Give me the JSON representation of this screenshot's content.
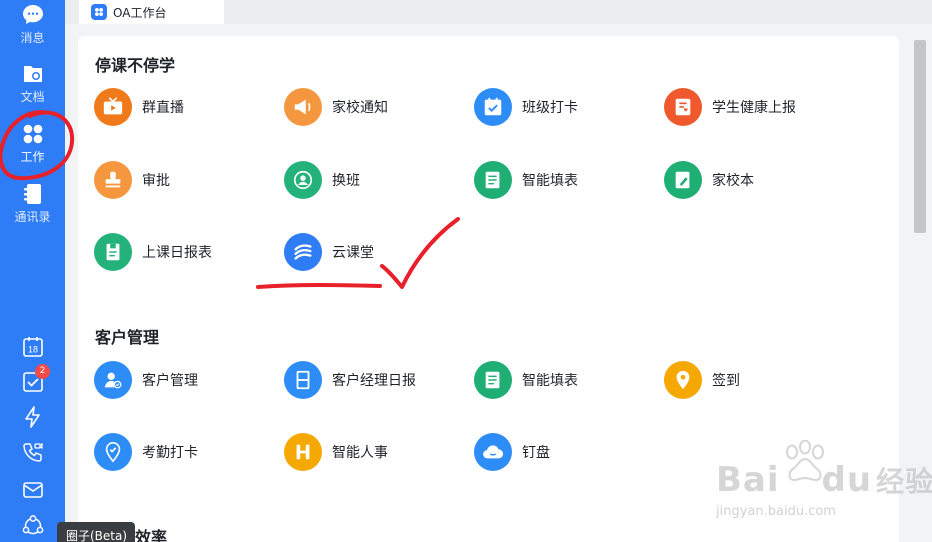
{
  "sidebar": {
    "nav": [
      {
        "label": "消息",
        "icon": "chat-bubble-icon"
      },
      {
        "label": "文档",
        "icon": "document-folder-icon"
      },
      {
        "label": "工作",
        "icon": "workbench-grid-icon",
        "active": true
      },
      {
        "label": "通讯录",
        "icon": "contacts-book-icon"
      }
    ],
    "bottom_icons": [
      "calendar-icon",
      "todo-check-icon",
      "lightning-icon",
      "phone-video-icon",
      "mail-icon",
      "circle-network-icon"
    ],
    "calendar_day": "18",
    "todo_badge": "2",
    "tooltip": "圈子(Beta)"
  },
  "tab": {
    "label": "OA工作台"
  },
  "sections": [
    {
      "title": "停课不停学",
      "apps": [
        {
          "name": "群直播",
          "color": "#f07a1a",
          "icon": "tv-live-icon"
        },
        {
          "name": "家校通知",
          "color": "#f5973f",
          "icon": "megaphone-icon"
        },
        {
          "name": "班级打卡",
          "color": "#2e8cf6",
          "icon": "calendar-check-icon"
        },
        {
          "name": "学生健康上报",
          "color": "#f0582d",
          "icon": "health-report-icon"
        },
        {
          "name": "审批",
          "color": "#f5973f",
          "icon": "stamp-icon"
        },
        {
          "name": "换班",
          "color": "#25b27a",
          "icon": "person-swap-icon"
        },
        {
          "name": "智能填表",
          "color": "#1fae73",
          "icon": "form-sheet-icon"
        },
        {
          "name": "家校本",
          "color": "#1fae73",
          "icon": "notebook-pen-icon"
        },
        {
          "name": "上课日报表",
          "color": "#25b27a",
          "icon": "daily-report-icon"
        },
        {
          "name": "云课堂",
          "color": "#2e7cf6",
          "icon": "cloud-class-icon"
        }
      ]
    },
    {
      "title": "客户管理",
      "apps": [
        {
          "name": "客户管理",
          "color": "#2e8cf6",
          "icon": "customer-person-icon"
        },
        {
          "name": "客户经理日报",
          "color": "#2e8cf6",
          "icon": "manager-daily-icon"
        },
        {
          "name": "智能填表",
          "color": "#1fae73",
          "icon": "form-sheet-icon"
        },
        {
          "name": "签到",
          "color": "#f5a800",
          "icon": "location-pin-icon"
        },
        {
          "name": "考勤打卡",
          "color": "#2e8cf6",
          "icon": "attendance-pin-icon"
        },
        {
          "name": "智能人事",
          "color": "#f5a800",
          "icon": "hr-h-icon"
        },
        {
          "name": "钉盘",
          "color": "#2e8cf6",
          "icon": "cloud-disk-icon"
        }
      ]
    },
    {
      "title": "效率"
    }
  ],
  "watermark": {
    "brand": "Bai",
    "brand2": "du",
    "brand_cn": "经验",
    "url": "jingyan.baidu.com"
  },
  "annotation_colors": {
    "circle": "#e8202a",
    "check": "#e8202a"
  }
}
